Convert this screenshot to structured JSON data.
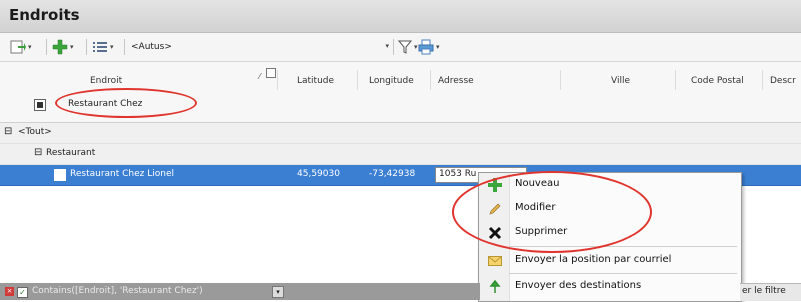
{
  "window": {
    "title": "Endroits"
  },
  "toolbar": {
    "filter_value": "<Autus>",
    "dropdown_arrow": "▾"
  },
  "columns": [
    "Endroit",
    "Latitude",
    "Longitude",
    "Adresse",
    "Ville",
    "Code Postal",
    "Descr"
  ],
  "filter_row": {
    "endroit_value": "Restaurant Chez"
  },
  "groups": {
    "all": "<Tout>",
    "sub": "Restaurant"
  },
  "record": {
    "endroit": "Restaurant Chez Lionel",
    "latitude": "45,59030",
    "longitude": "-73,42938",
    "adresse": "1053 Ru"
  },
  "context_menu": {
    "items": [
      {
        "label": "Nouveau",
        "icon": "plus-icon"
      },
      {
        "label": "Modifier",
        "icon": "pencil-icon"
      },
      {
        "label": "Supprimer",
        "icon": "delete-x-icon"
      },
      {
        "label": "Envoyer la position par courriel",
        "icon": "email-icon"
      },
      {
        "label": "Envoyer des destinations",
        "icon": "destination-arrow-icon"
      }
    ]
  },
  "status_bar": {
    "filter_text": "Contains([Endroit], 'Restaurant Chez')",
    "clear_filter": "er le filtre"
  },
  "colors": {
    "selection": "#3b7fd3",
    "annotation": "#e0352e",
    "add": "#3aa53a"
  }
}
